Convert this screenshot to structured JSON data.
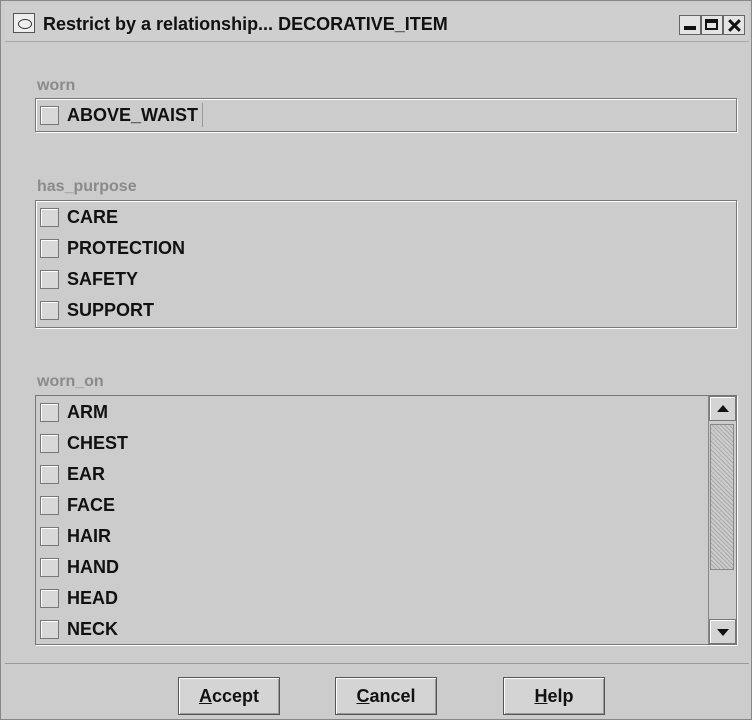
{
  "window": {
    "title": "Restrict by a relationship... DECORATIVE_ITEM"
  },
  "sections": {
    "worn": {
      "label": "worn",
      "items": [
        "ABOVE_WAIST"
      ]
    },
    "has_purpose": {
      "label": "has_purpose",
      "items": [
        "CARE",
        "PROTECTION",
        "SAFETY",
        "SUPPORT"
      ]
    },
    "worn_on": {
      "label": "worn_on",
      "items": [
        "ARM",
        "CHEST",
        "EAR",
        "FACE",
        "HAIR",
        "HAND",
        "HEAD",
        "NECK"
      ]
    }
  },
  "buttons": {
    "accept": {
      "first": "A",
      "rest": "ccept"
    },
    "cancel": {
      "first": "C",
      "rest": "ancel"
    },
    "help": {
      "first": "H",
      "rest": "elp"
    }
  }
}
